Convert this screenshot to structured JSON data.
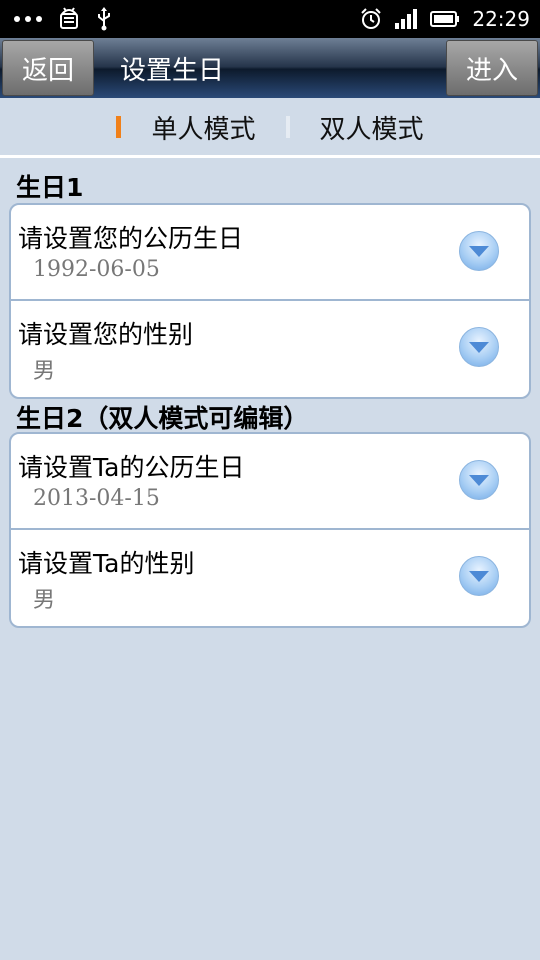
{
  "status_bar": {
    "time": "22:29",
    "icons": [
      "more-dots-icon",
      "android-debug-icon",
      "usb-icon",
      "alarm-icon",
      "signal-icon",
      "battery-icon"
    ]
  },
  "title_bar": {
    "back_label": "返回",
    "title": "设置生日",
    "enter_label": "进入"
  },
  "mode_tabs": {
    "single": "单人模式",
    "double": "双人模式",
    "active_color": "#f08019"
  },
  "sections": [
    {
      "title": "生日1",
      "rows": [
        {
          "label": "请设置您的公历生日",
          "value": "1992-06-05"
        },
        {
          "label": "请设置您的性别",
          "value": "男"
        }
      ]
    },
    {
      "title": "生日2（双人模式可编辑）",
      "rows": [
        {
          "label": "请设置Ta的公历生日",
          "value": "2013-04-15"
        },
        {
          "label": "请设置Ta的性别",
          "value": "男"
        }
      ]
    }
  ]
}
